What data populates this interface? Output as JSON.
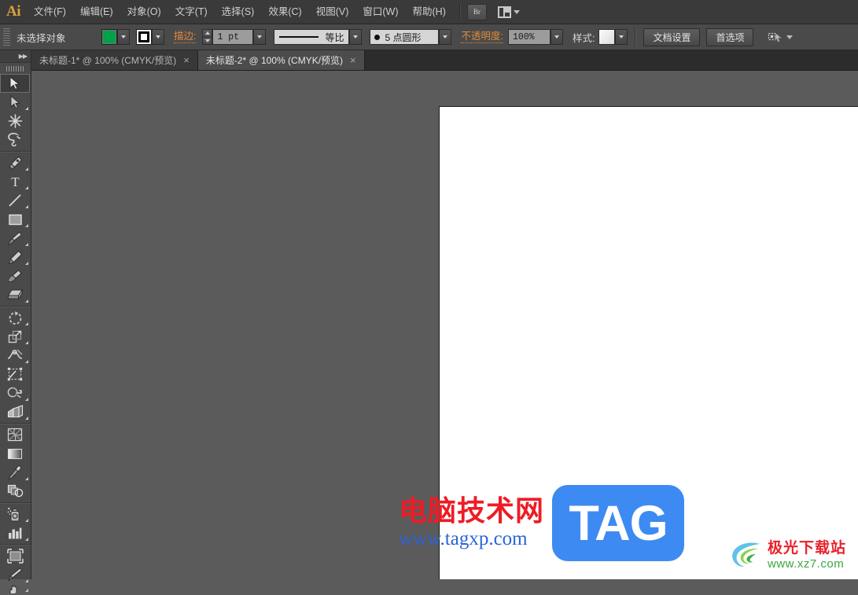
{
  "app": {
    "name": "Ai",
    "logo_color": "#d9a23a"
  },
  "menubar": {
    "items": [
      {
        "label": "文件(F)",
        "name": "menu-file"
      },
      {
        "label": "编辑(E)",
        "name": "menu-edit"
      },
      {
        "label": "对象(O)",
        "name": "menu-object"
      },
      {
        "label": "文字(T)",
        "name": "menu-type"
      },
      {
        "label": "选择(S)",
        "name": "menu-select"
      },
      {
        "label": "效果(C)",
        "name": "menu-effect"
      },
      {
        "label": "视图(V)",
        "name": "menu-view"
      },
      {
        "label": "窗口(W)",
        "name": "menu-window"
      },
      {
        "label": "帮助(H)",
        "name": "menu-help"
      }
    ],
    "bridge_button": "Br",
    "workspace_switcher_icon": "workspace-layout-icon"
  },
  "controlbar": {
    "selection_status": "未选择对象",
    "fill_label": "fill-swatch",
    "fill_color": "#00a14b",
    "stroke_icon": "stroke-swatch-icon",
    "stroke_label": "描边:",
    "stroke_weight_value": "1 pt",
    "stroke_profile_value": "等比",
    "stroke_brush_value": "5 点圆形",
    "opacity_label": "不透明度:",
    "opacity_value": "100%",
    "style_label": "样式:",
    "document_setup_button": "文档设置",
    "preferences_button": "首选项",
    "align_pixel_icon": "align-to-pixel-grid-icon"
  },
  "tabs": [
    {
      "title": "未标题-1* @ 100% (CMYK/预览)",
      "active": false,
      "close": "×"
    },
    {
      "title": "未标题-2* @ 100% (CMYK/预览)",
      "active": true,
      "close": "×"
    }
  ],
  "toolbar": {
    "collapse_icon": "double-chevron-right-icon",
    "groups": [
      {
        "tools": [
          {
            "name": "selection-tool",
            "icon": "arrow-solid-icon",
            "active": true,
            "more": false
          },
          {
            "name": "direct-selection-tool",
            "icon": "arrow-hollow-icon",
            "active": false,
            "more": true
          },
          {
            "name": "magic-wand-tool",
            "icon": "magic-wand-icon",
            "active": false,
            "more": false
          },
          {
            "name": "lasso-tool",
            "icon": "lasso-icon",
            "active": false,
            "more": false
          }
        ]
      },
      {
        "tools": [
          {
            "name": "pen-tool",
            "icon": "pen-nib-icon",
            "active": false,
            "more": true
          },
          {
            "name": "type-tool",
            "icon": "type-T-icon",
            "active": false,
            "more": true
          },
          {
            "name": "line-segment-tool",
            "icon": "line-diagonal-icon",
            "active": false,
            "more": true
          },
          {
            "name": "rectangle-tool",
            "icon": "rectangle-icon",
            "active": false,
            "more": true
          },
          {
            "name": "paintbrush-tool",
            "icon": "paintbrush-icon",
            "active": false,
            "more": true
          },
          {
            "name": "pencil-tool",
            "icon": "pencil-icon",
            "active": false,
            "more": true
          },
          {
            "name": "blob-brush-tool",
            "icon": "blob-brush-icon",
            "active": false,
            "more": false
          },
          {
            "name": "eraser-tool",
            "icon": "eraser-icon",
            "active": false,
            "more": true
          }
        ]
      },
      {
        "tools": [
          {
            "name": "rotate-tool",
            "icon": "rotate-icon",
            "active": false,
            "more": true
          },
          {
            "name": "scale-tool",
            "icon": "scale-icon",
            "active": false,
            "more": true
          },
          {
            "name": "width-tool",
            "icon": "width-warp-icon",
            "active": false,
            "more": true
          },
          {
            "name": "free-transform-tool",
            "icon": "free-transform-icon",
            "active": false,
            "more": false
          },
          {
            "name": "shape-builder-tool",
            "icon": "shape-builder-icon",
            "active": false,
            "more": true
          },
          {
            "name": "perspective-grid-tool",
            "icon": "perspective-grid-icon",
            "active": false,
            "more": true
          }
        ]
      },
      {
        "tools": [
          {
            "name": "mesh-tool",
            "icon": "mesh-icon",
            "active": false,
            "more": false
          },
          {
            "name": "gradient-tool",
            "icon": "gradient-icon",
            "active": false,
            "more": false
          },
          {
            "name": "eyedropper-tool",
            "icon": "eyedropper-icon",
            "active": false,
            "more": true
          },
          {
            "name": "blend-tool",
            "icon": "blend-icon",
            "active": false,
            "more": false
          }
        ]
      },
      {
        "tools": [
          {
            "name": "symbol-sprayer-tool",
            "icon": "symbol-sprayer-icon",
            "active": false,
            "more": true
          },
          {
            "name": "column-graph-tool",
            "icon": "bar-graph-icon",
            "active": false,
            "more": true
          }
        ]
      },
      {
        "tools": [
          {
            "name": "artboard-tool",
            "icon": "artboard-icon",
            "active": false,
            "more": false
          },
          {
            "name": "slice-tool",
            "icon": "slice-knife-icon",
            "active": false,
            "more": true
          },
          {
            "name": "hand-tool",
            "icon": "hand-partial-icon",
            "active": false,
            "more": true
          }
        ]
      }
    ]
  },
  "canvas": {
    "background_color": "#5b5b5b",
    "artboard_color": "#ffffff"
  },
  "watermarks": {
    "tagxp": {
      "headline": "电脑技术网",
      "url": "www.tagxp.com",
      "badge": "TAG",
      "headline_color": "#ee1c25",
      "url_color": "#2a63d8",
      "badge_color": "#3d8bf2"
    },
    "xz7": {
      "headline": "极光下载站",
      "url": "www.xz7.com",
      "headline_color": "#e9212b",
      "url_color": "#37a93c"
    }
  }
}
